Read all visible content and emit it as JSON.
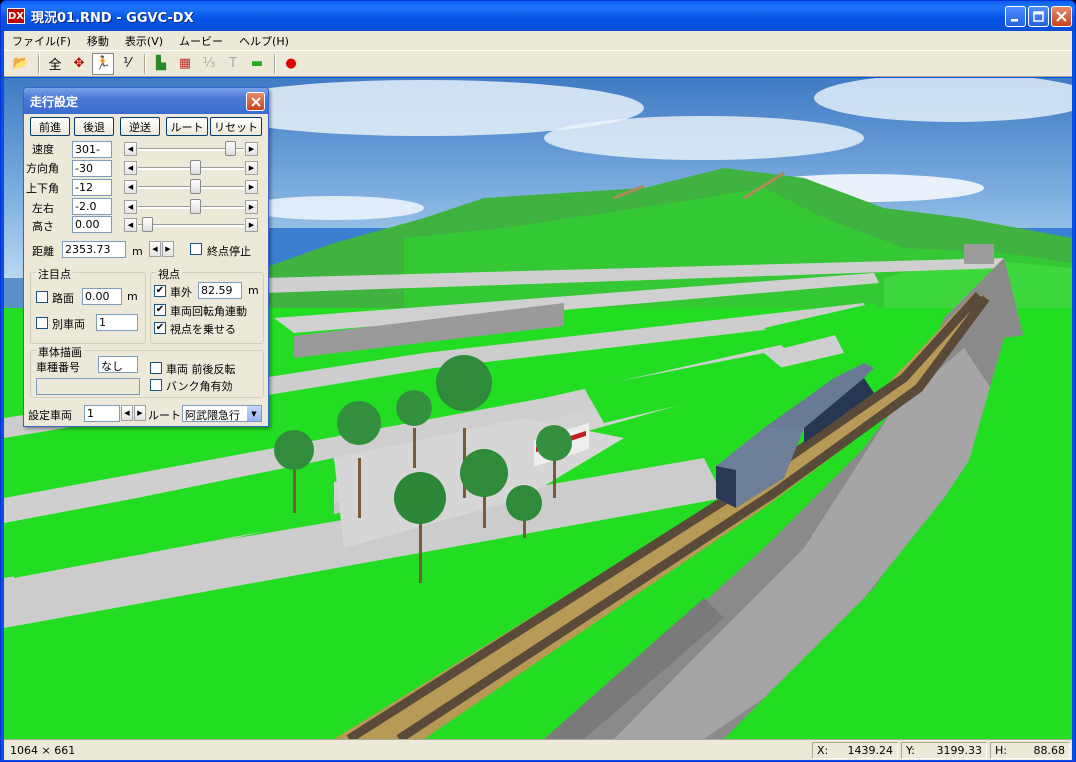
{
  "window": {
    "title": "現況01.RND - GGVC-DX",
    "icon_text": "DX"
  },
  "menu": [
    {
      "label": "ファイル(F)"
    },
    {
      "label": "移動"
    },
    {
      "label": "表示(V)"
    },
    {
      "label": "ムービー"
    },
    {
      "label": "ヘルプ(H)"
    }
  ],
  "toolbar": {
    "tools": [
      {
        "icon": "open-folder-icon",
        "glyph": "📂"
      },
      {
        "icon": "all-view-icon",
        "glyph": "全"
      },
      {
        "icon": "move-cross-icon",
        "glyph": "✥"
      },
      {
        "icon": "runner-icon",
        "glyph": "🏃"
      },
      {
        "icon": "scale-icon",
        "glyph": "⅟"
      },
      {
        "icon": "terrain-icon",
        "glyph": "▙"
      },
      {
        "icon": "color-grid-icon",
        "glyph": "▦"
      },
      {
        "icon": "vector-icon",
        "glyph": "⅓"
      },
      {
        "icon": "text-icon",
        "glyph": "T"
      },
      {
        "icon": "grass-icon",
        "glyph": "▬"
      },
      {
        "icon": "record-icon",
        "glyph": "●"
      }
    ]
  },
  "dialog": {
    "title": "走行設定",
    "buttons": {
      "forward": "前進",
      "backward": "後退",
      "reverse": "逆送",
      "route": "ルート",
      "reset": "リセット"
    },
    "rows": {
      "speed": {
        "label": "速度",
        "value": "301-",
        "thumb": 0.92
      },
      "heading": {
        "label": "方向角",
        "value": "-30",
        "thumb": 0.55
      },
      "pitch": {
        "label": "上下角",
        "value": "-12",
        "thumb": 0.55
      },
      "lateral": {
        "label": "左右",
        "value": "-2.0",
        "thumb": 0.55
      },
      "height": {
        "label": "高さ",
        "value": "0.00",
        "thumb": 0.04
      }
    },
    "distance": {
      "label": "距離",
      "value": "2353.73",
      "unit": "m",
      "end_stop_label": "終点停止",
      "end_stop_checked": false
    },
    "focus": {
      "title": "注目点",
      "road_label": "路面",
      "road_value": "0.00",
      "road_unit": "m",
      "road_checked": false,
      "other_vehicle_label": "別車両",
      "other_vehicle_value": "1",
      "other_vehicle_checked": false
    },
    "viewpoint": {
      "title": "視点",
      "outside_label": "車外",
      "outside_value": "82.59",
      "outside_unit": "m",
      "outside_checked": true,
      "rotation_label": "車両回転角連動",
      "rotation_checked": true,
      "ride_label": "視点を乗せる",
      "ride_checked": true
    },
    "body": {
      "title": "車体描画",
      "type_label": "車種番号",
      "type_value": "なし",
      "flip_label": "車両 前後反転",
      "flip_checked": false,
      "bank_label": "バンク角有効",
      "bank_checked": false
    },
    "footer": {
      "vehicle_label": "設定車両",
      "vehicle_value": "1",
      "route_label": "ルート",
      "route_value": "阿武隈急行"
    }
  },
  "status": {
    "size": "1064 × 661",
    "x_label": "X:",
    "x_value": "1439.24",
    "y_label": "Y:",
    "y_value": "3199.33",
    "h_label": "H:",
    "h_value": "88.68"
  }
}
